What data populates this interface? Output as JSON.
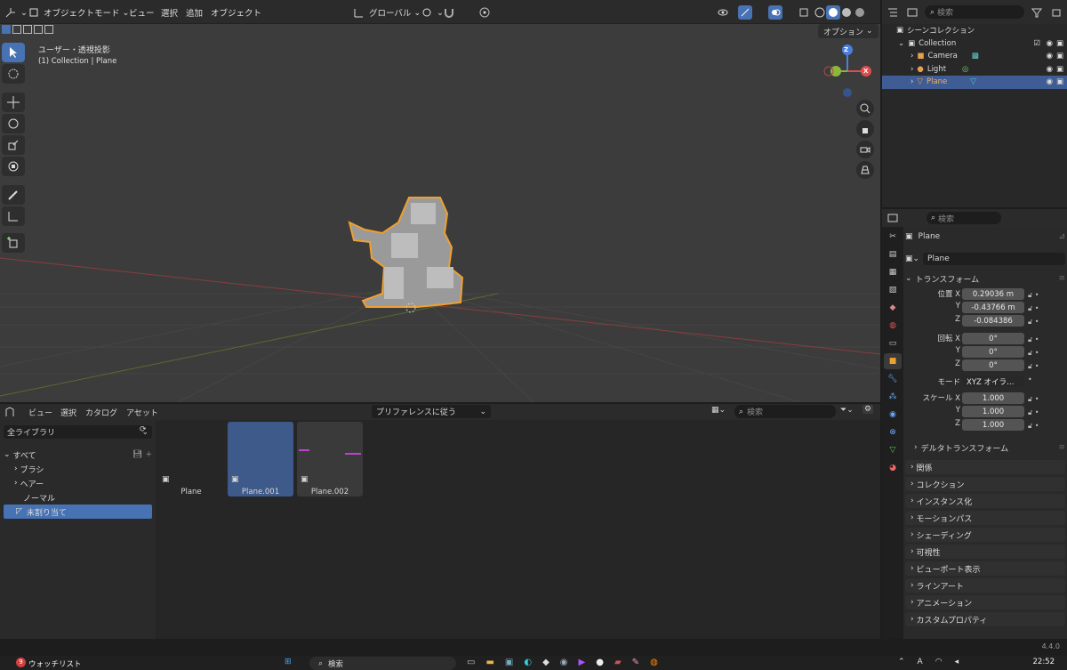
{
  "viewport": {
    "mode": "オブジェクトモード",
    "menus": [
      "ビュー",
      "選択",
      "追加",
      "オブジェクト"
    ],
    "transform_orientation": "グローバル",
    "options": "オプション",
    "view_name": "ユーザー・透視投影",
    "view_sub": "(1) Collection | Plane",
    "gizmo": {
      "z": "Z",
      "x": "X"
    }
  },
  "outliner": {
    "search_placeholder": "検索",
    "scene_collection": "シーンコレクション",
    "items": [
      {
        "label": "Collection"
      },
      {
        "label": "Camera"
      },
      {
        "label": "Light"
      },
      {
        "label": "Plane"
      }
    ]
  },
  "properties": {
    "search_placeholder": "検索",
    "object_name": "Plane",
    "data_name": "Plane",
    "transform_label": "トランスフォーム",
    "location_label": "位置 X",
    "loc": {
      "x": "0.29036 m",
      "y": "-0.43766 m",
      "z": "-0.084386"
    },
    "rotation_label": "回転 X",
    "rot": {
      "x": "0°",
      "y": "0°",
      "z": "0°"
    },
    "mode_label": "モード",
    "mode_value": "XYZ オイラ…",
    "scale_label": "スケール X",
    "scale": {
      "x": "1.000",
      "y": "1.000",
      "z": "1.000"
    },
    "axis": {
      "y": "Y",
      "z": "Z"
    },
    "delta": "デルタトランスフォーム",
    "panels": [
      "関係",
      "コレクション",
      "インスタンス化",
      "モーションパス",
      "シェーディング",
      "可視性",
      "ビューポート表示",
      "ラインアート",
      "アニメーション",
      "カスタムプロパティ"
    ]
  },
  "asset_browser": {
    "menus": [
      "ビュー",
      "選択",
      "カタログ",
      "アセット"
    ],
    "import_method": "プリファレンスに従う",
    "search_placeholder": "検索",
    "library": "全ライブラリ",
    "tree": {
      "all": "すべて",
      "brush": "ブラシ",
      "hair": "ヘアー",
      "normal": "ノーマル",
      "unassigned": "未割り当て"
    },
    "assets": [
      "Plane",
      "Plane.001",
      "Plane.002"
    ]
  },
  "status": {
    "version": "4.4.0"
  },
  "taskbar": {
    "badge": "9",
    "watchlist": "ウォッチリスト",
    "search": "検索",
    "time": "22:52"
  },
  "colors": {
    "accent": "#4772b3",
    "selection_outline": "#f0a030",
    "x_axis": "#e04d4d",
    "y_axis": "#89b83c",
    "z_axis": "#4a7fdc"
  }
}
